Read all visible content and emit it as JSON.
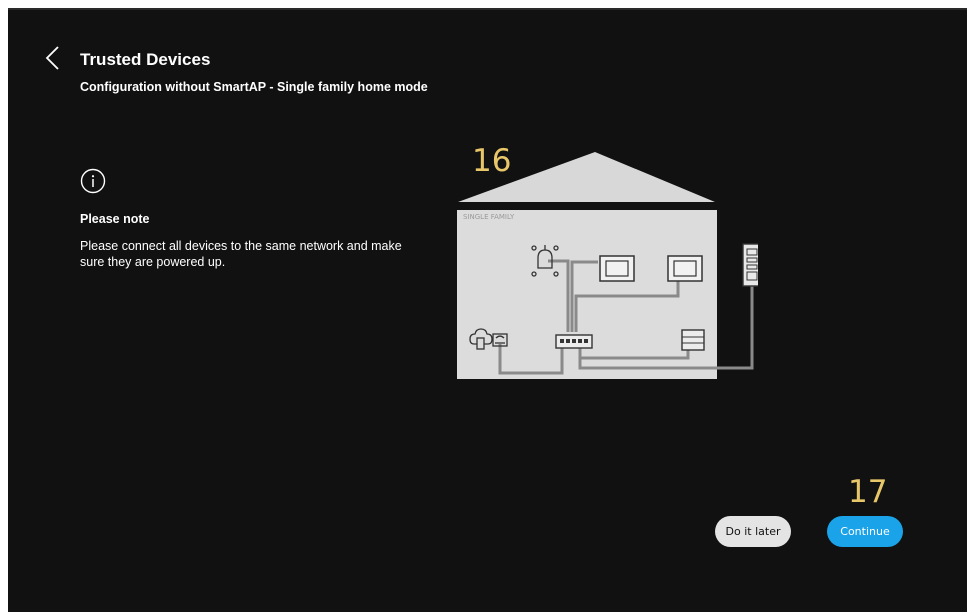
{
  "header": {
    "title": "Trusted Devices",
    "subtitle": "Configuration without SmartAP - Single family home mode"
  },
  "note": {
    "title": "Please note",
    "text": "Please connect all devices to the same network and make sure they are powered up."
  },
  "diagram": {
    "house_label": "SINGLE FAMILY"
  },
  "annotations": {
    "a16": "16",
    "a17": "17"
  },
  "buttons": {
    "later_label": "Do it later",
    "continue_label": "Continue"
  },
  "colors": {
    "background": "#111111",
    "accent": "#1aa3e8",
    "annotation": "#e8c66a"
  },
  "icons": {
    "back": "chevron-left-icon",
    "info": "info-circle-icon"
  }
}
